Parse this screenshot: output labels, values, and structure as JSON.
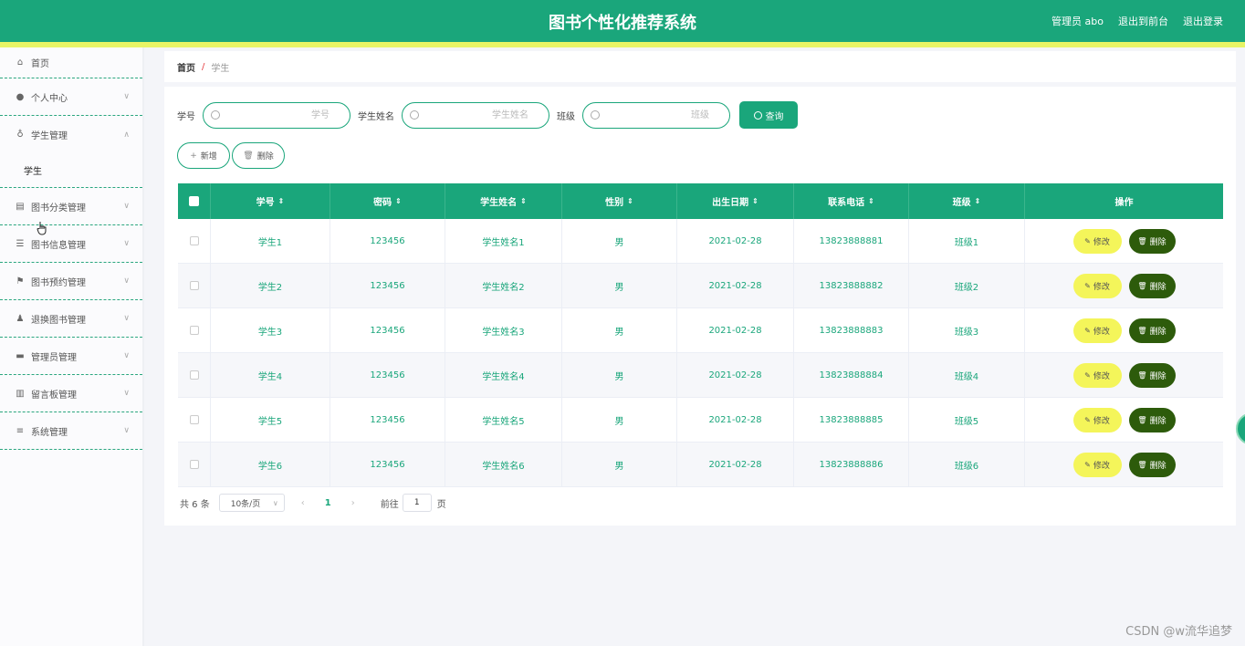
{
  "header": {
    "title": "图书个性化推荐系统",
    "user": "管理员 abo",
    "front_link": "退出到前台",
    "logout_link": "退出登录"
  },
  "sidebar": {
    "home": "首页",
    "items": [
      {
        "label": "个人中心",
        "icon": "user-icon"
      },
      {
        "label": "学生管理",
        "icon": "mic-icon",
        "expanded": true,
        "children": [
          "学生"
        ]
      },
      {
        "label": "图书分类管理",
        "icon": "chart-icon"
      },
      {
        "label": "图书信息管理",
        "icon": "list-icon"
      },
      {
        "label": "图书预约管理",
        "icon": "flag-icon"
      },
      {
        "label": "退换图书管理",
        "icon": "person-icon"
      },
      {
        "label": "管理员管理",
        "icon": "monitor-icon"
      },
      {
        "label": "留言板管理",
        "icon": "bar-chart-icon"
      },
      {
        "label": "系统管理",
        "icon": "menu-icon"
      }
    ]
  },
  "breadcrumb": {
    "home": "首页",
    "sep": "/",
    "current": "学生"
  },
  "search": {
    "label_id": "学号",
    "placeholder_id": "学号",
    "label_name": "学生姓名",
    "placeholder_name": "学生姓名",
    "label_class": "班级",
    "placeholder_class": "班级",
    "button": "查询"
  },
  "actions": {
    "add": "新增",
    "delete": "删除"
  },
  "table": {
    "headers": [
      "学号",
      "密码",
      "学生姓名",
      "性别",
      "出生日期",
      "联系电话",
      "班级",
      "操作"
    ],
    "rows": [
      [
        "学生1",
        "123456",
        "学生姓名1",
        "男",
        "2021-02-28",
        "13823888881",
        "班级1"
      ],
      [
        "学生2",
        "123456",
        "学生姓名2",
        "男",
        "2021-02-28",
        "13823888882",
        "班级2"
      ],
      [
        "学生3",
        "123456",
        "学生姓名3",
        "男",
        "2021-02-28",
        "13823888883",
        "班级3"
      ],
      [
        "学生4",
        "123456",
        "学生姓名4",
        "男",
        "2021-02-28",
        "13823888884",
        "班级4"
      ],
      [
        "学生5",
        "123456",
        "学生姓名5",
        "男",
        "2021-02-28",
        "13823888885",
        "班级5"
      ],
      [
        "学生6",
        "123456",
        "学生姓名6",
        "男",
        "2021-02-28",
        "13823888886",
        "班级6"
      ]
    ],
    "edit_label": "修改",
    "delete_label": "删除"
  },
  "pagination": {
    "total": "共 6 条",
    "page_size": "10条/页",
    "current_page": "1",
    "goto_label": "前往",
    "goto_value": "1",
    "page_suffix": "页"
  },
  "watermark": "CSDN @w流华追梦",
  "colors": {
    "primary": "#1aa67b",
    "stripe": "#e8f466",
    "edit": "#f4f55a",
    "delete": "#2d5b0b"
  }
}
